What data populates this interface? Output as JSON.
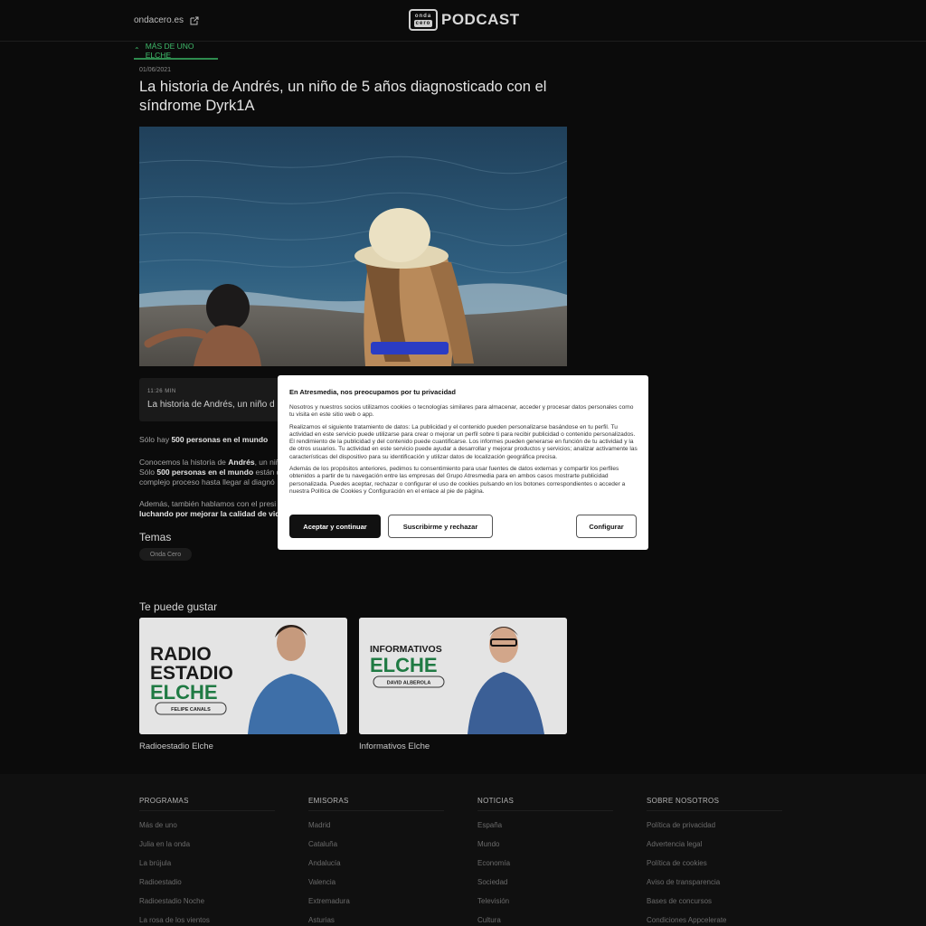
{
  "header": {
    "site_link": "ondacero.es",
    "logo_badge_top": "onda",
    "logo_badge_bottom": "cero",
    "logo_text": "PODCAST"
  },
  "program": {
    "label": "MÁS DE UNO ELCHE"
  },
  "article": {
    "date": "01/06/2021",
    "title": "La historia de Andrés, un niño de 5 años diagnosticado con el síndrome Dyrk1A"
  },
  "episode": {
    "duration": "11:26 MIN",
    "title": "La historia de Andrés, un niño d"
  },
  "body": {
    "p1_a": "Sólo hay ",
    "p1_b": "500 personas en el mundo",
    "p2_l1_a": "Conocemos la historia de ",
    "p2_l1_b": "Andrés",
    "p2_l1_c": ", un niñ",
    "p2_l2_a": "Sólo ",
    "p2_l2_b": "500 personas en el mundo",
    "p2_l2_c": " están d",
    "p2_l3": "complejo proceso hasta llegar al diagnó",
    "p3_l1": "Además, también hablamos con el presi",
    "p3_l2": "luchando por mejorar la calidad de vida"
  },
  "temas": {
    "heading": "Temas",
    "tag": "Onda Cero"
  },
  "recommendations": {
    "heading": "Te puede gustar",
    "items": [
      {
        "label": "Radioestadio Elche",
        "art_l1": "RADIO",
        "art_l2": "ESTADIO",
        "art_l3": "ELCHE",
        "art_name": "FELIPE CANALS"
      },
      {
        "label": "Informativos Elche",
        "art_l1": "INFORMATIVOS",
        "art_l2": "ELCHE",
        "art_name": "DAVID ALBEROLA"
      }
    ]
  },
  "footer": {
    "columns": [
      {
        "heading": "PROGRAMAS",
        "items": [
          "Más de uno",
          "Julia en la onda",
          "La brújula",
          "Radioestadio",
          "Radioestadio Noche",
          "La rosa de los vientos"
        ]
      },
      {
        "heading": "EMISORAS",
        "items": [
          "Madrid",
          "Cataluña",
          "Andalucía",
          "Valencia",
          "Extremadura",
          "Asturias"
        ]
      },
      {
        "heading": "NOTICIAS",
        "items": [
          "España",
          "Mundo",
          "Economía",
          "Sociedad",
          "Televisión",
          "Cultura"
        ]
      },
      {
        "heading": "SOBRE NOSOTROS",
        "items": [
          "Política de privacidad",
          "Advertencia legal",
          "Política de cookies",
          "Aviso de transparencia",
          "Bases de concursos",
          "Condiciones Appcelerate"
        ]
      }
    ]
  },
  "cookie_modal": {
    "title": "En Atresmedia, nos preocupamos por tu privacidad",
    "p1": "Nosotros y nuestros socios utilizamos cookies o tecnologías similares para almacenar, acceder y procesar datos personales como tu visita en este sitio web o app.",
    "p2": "Realizamos el siguiente tratamiento de datos: La publicidad y el contenido pueden personalizarse basándose en tu perfil. Tu actividad en este servicio puede utilizarse para crear o mejorar un perfil sobre ti para recibir publicidad o contenido personalizados. El rendimiento de la publicidad y del contenido puede cuantificarse. Los informes pueden generarse en función de tu actividad y la de otros usuarios. Tu actividad en este servicio puede ayudar a desarrollar y mejorar productos y servicios; analizar activamente las características del dispositivo para su identificación y utilizar datos de localización geográfica precisa.",
    "p3": "Además de los propósitos anteriores, pedimos tu consentimiento para usar fuentes de datos externas y compartir los perfiles obtenidos a partir de tu navegación entre las empresas del Grupo Atresmedia para en ambos casos mostrarte publicidad personalizada. Puedes aceptar, rechazar o configurar el uso de cookies pulsando en los botones correspondientes o acceder a nuestra Política de Cookies y Configuración en el enlace al pie de página.",
    "accept": "Aceptar y continuar",
    "subscribe": "Suscribirme y rechazar",
    "configure": "Configurar"
  }
}
